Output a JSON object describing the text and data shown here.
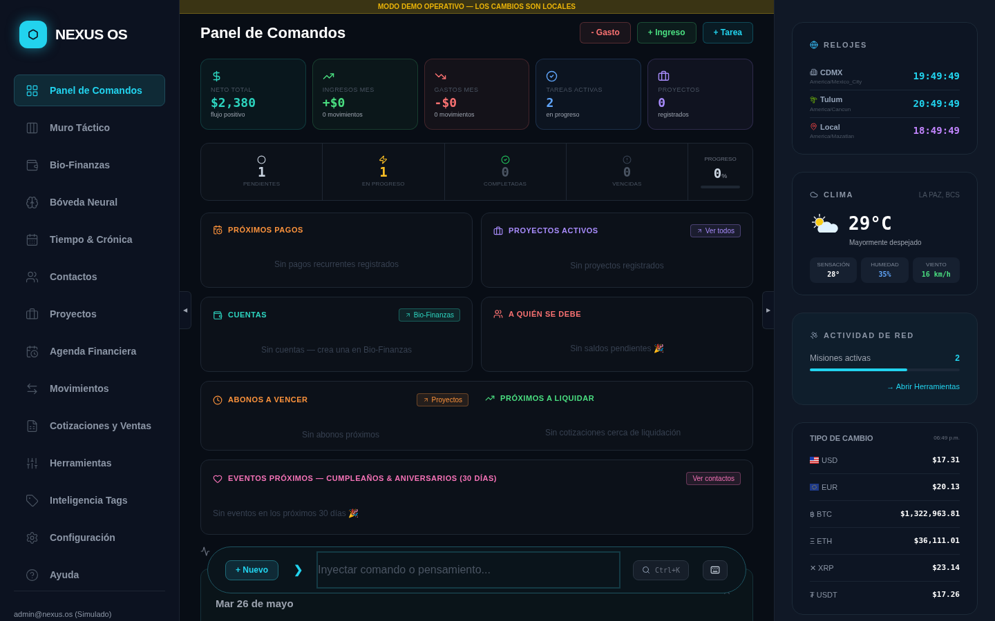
{
  "sidebar": {
    "logo": "NEXUS OS",
    "collapse": "◀",
    "items": [
      {
        "label": "Panel de Comandos",
        "selected": true
      },
      {
        "label": "Muro Táctico",
        "selected": false
      },
      {
        "label": "Bio-Finanzas",
        "selected": false
      },
      {
        "label": "Bóveda Neural",
        "selected": false
      },
      {
        "label": "Tiempo & Crónica",
        "selected": false
      },
      {
        "label": "Contactos",
        "selected": false
      },
      {
        "label": "Proyectos",
        "selected": false
      },
      {
        "label": "Agenda Financiera",
        "selected": false
      },
      {
        "label": "Movimientos",
        "selected": false
      },
      {
        "label": "Cotizaciones y Ventas",
        "selected": false
      },
      {
        "label": "Herramientas",
        "selected": false
      },
      {
        "label": "Inteligencia Tags",
        "selected": false
      },
      {
        "label": "Configuración",
        "selected": false
      },
      {
        "label": "Ayuda",
        "selected": false
      }
    ],
    "footer": "admin@nexus.os (Simulado)"
  },
  "banner": "MODO DEMO OPERATIVO — LOS CAMBIOS SON LOCALES",
  "header": {
    "title": "Panel de Comandos",
    "actions": [
      {
        "label": "- Gasto",
        "color": "#f87171"
      },
      {
        "label": "+ Ingreso",
        "color": "#4ade80"
      },
      {
        "label": "+ Tarea",
        "color": "#22d3ee"
      }
    ]
  },
  "stats": [
    {
      "label": "NETO TOTAL",
      "value": "$2,380",
      "sub": "flujo positivo",
      "color": "#2dd4bf"
    },
    {
      "label": "INGRESOS MES",
      "value": "+$0",
      "sub": "0 movimientos",
      "color": "#4ade80"
    },
    {
      "label": "GASTOS MES",
      "value": "-$0",
      "sub": "0 movimientos",
      "color": "#f87171"
    },
    {
      "label": "TAREAS ACTIVAS",
      "value": "2",
      "sub": "en progreso",
      "color": "#60a5fa"
    },
    {
      "label": "PROYECTOS",
      "value": "0",
      "sub": "registrados",
      "color": "#a78bfa"
    }
  ],
  "task_counts": {
    "items": [
      {
        "label": "PENDIENTES",
        "value": "1",
        "color": "#cbd5e1"
      },
      {
        "label": "EN PROGRESO",
        "value": "1",
        "color": "#fbbf24"
      },
      {
        "label": "COMPLETADAS",
        "value": "0",
        "color": "#4b5563"
      },
      {
        "label": "VENCIDAS",
        "value": "0",
        "color": "#4b5563"
      }
    ],
    "progress": {
      "label": "PROGRESO",
      "value": "0",
      "unit": "%",
      "level": 0
    }
  },
  "panel_rows": [
    {
      "kind": "pair",
      "items": [
        {
          "title": "PRÓXIMOS PAGOS",
          "color": "#fb923c",
          "empty": "Sin pagos recurrentes registrados"
        },
        {
          "title": "PROYECTOS ACTIVOS",
          "color": "#a78bfa",
          "link": "Ver todos",
          "empty": "Sin proyectos registrados"
        }
      ]
    },
    {
      "kind": "pair",
      "items": [
        {
          "title": "CUENTAS",
          "color": "#2dd4bf",
          "link": "Bio-Finanzas",
          "empty": "Sin cuentas — crea una en Bio-Finanzas"
        },
        {
          "title": "A QUIÉN SE DEBE",
          "color": "#f87171",
          "empty": "Sin saldos pendientes 🎉"
        }
      ]
    },
    {
      "kind": "split",
      "items": [
        {
          "title": "ABONOS A VENCER",
          "color": "#fb923c",
          "link": "Proyectos",
          "empty": "Sin abonos próximos"
        },
        {
          "title": "PRÓXIMOS A LIQUIDAR",
          "color": "#4ade80",
          "empty": "Sin cotizaciones cerca de liquidación"
        }
      ]
    },
    {
      "kind": "single",
      "items": [
        {
          "title": "EVENTOS PRÓXIMOS — CUMPLEAÑOS & ANIVERSARIOS (30 DÍAS)",
          "color": "#f472b6",
          "link": "Ver contactos",
          "empty": "Sin eventos en los próximos 30 días 🎉"
        }
      ]
    }
  ],
  "command_bar": {
    "new_button": "+ Nuevo",
    "prompt": "❯",
    "placeholder": "Inyectar comando o pensamiento...",
    "shortcut": "Ctrl+K"
  },
  "day_card": {
    "date": "Mar 26 de mayo"
  },
  "right_collapse": "▶",
  "clocks": {
    "title": "RELOJES",
    "items": [
      {
        "name": "CDMX",
        "zone": "America/Mexico_City",
        "time": "19:49:49",
        "color": "#22d3ee"
      },
      {
        "name": "Tulum",
        "zone": "America/Cancun",
        "time": "20:49:49",
        "color": "#22d3ee"
      },
      {
        "name": "Local",
        "zone": "America/Mazatlan",
        "time": "18:49:49",
        "color": "#c084fc"
      }
    ]
  },
  "weather": {
    "title": "CLIMA",
    "location": "LA PAZ, BCS",
    "temp": "29°C",
    "description": "Mayormente despejado",
    "metrics": [
      {
        "label": "SENSACIÓN",
        "value": "28°",
        "color": "#ffffff"
      },
      {
        "label": "HUMEDAD",
        "value": "35%",
        "color": "#60a5fa"
      },
      {
        "label": "VIENTO",
        "value": "16 km/h",
        "color": "#4ade80"
      }
    ]
  },
  "network": {
    "title": "ACTIVIDAD DE RED",
    "label": "Misiones activas",
    "count": "2",
    "level": 0.65,
    "link": "→ Abrir Herramientas"
  },
  "exchange": {
    "title": "TIPO DE CAMBIO",
    "time": "06:49 p.m.",
    "rows": [
      {
        "kind": "flag",
        "label": "USD",
        "value": "$17.31"
      },
      {
        "kind": "flag",
        "label": "EUR",
        "value": "$20.13"
      },
      {
        "kind": "symbol",
        "label": "฿ BTC",
        "value": "$1,322,963.81"
      },
      {
        "kind": "symbol",
        "label": "Ξ ETH",
        "value": "$36,111.01"
      },
      {
        "kind": "symbol",
        "label": "✕ XRP",
        "value": "$23.14"
      },
      {
        "kind": "symbol",
        "label": "₮ USDT",
        "value": "$17.26"
      }
    ]
  }
}
